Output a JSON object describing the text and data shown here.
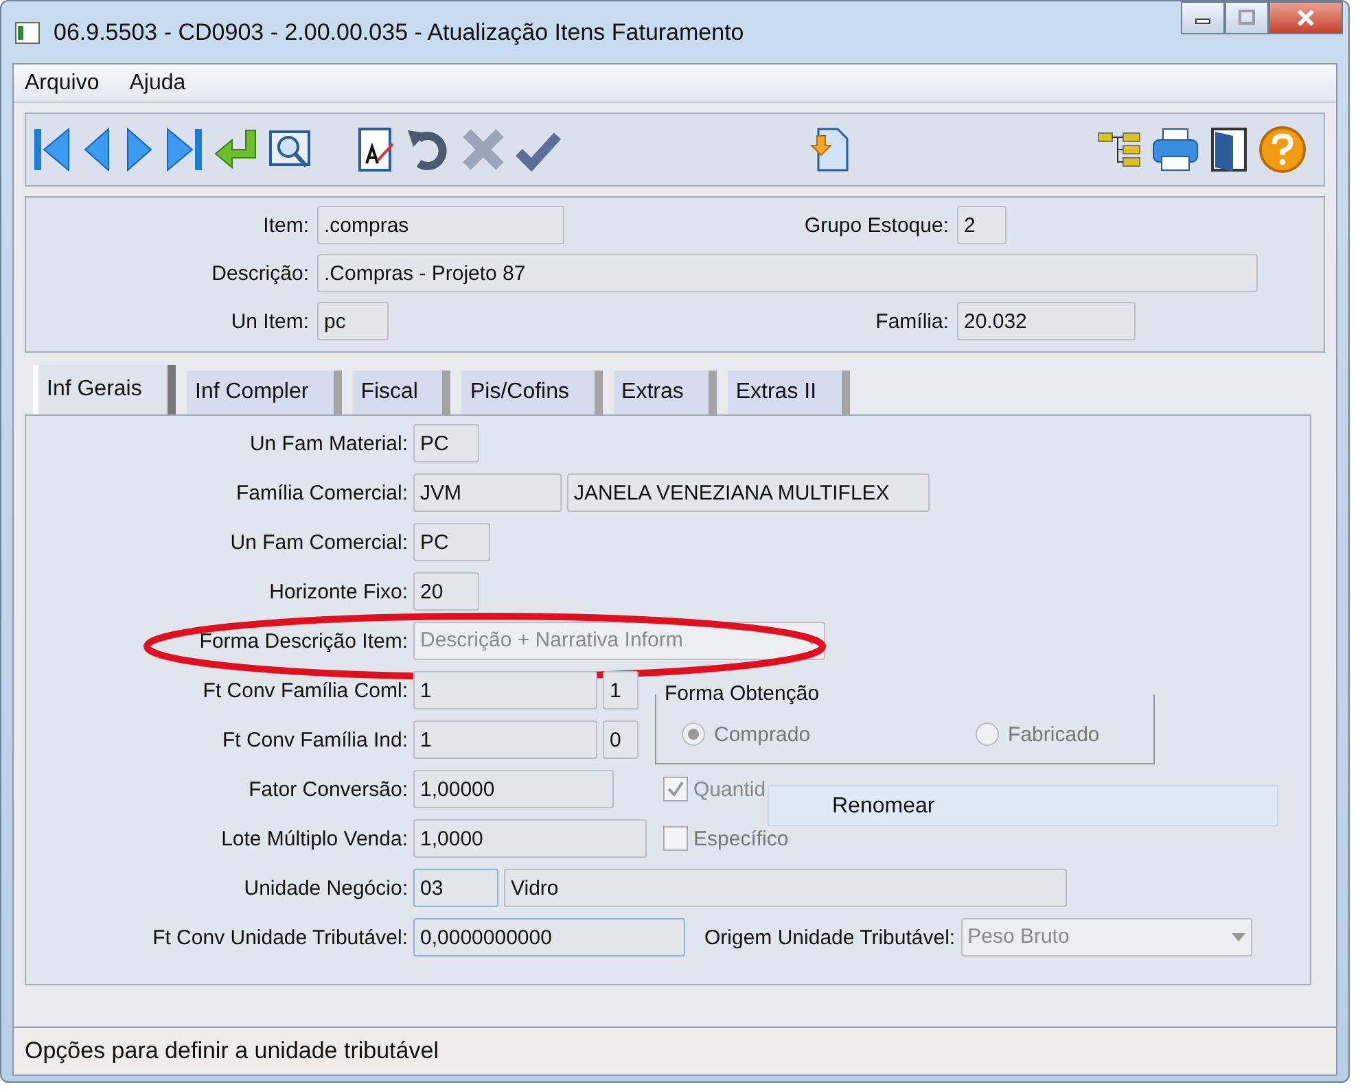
{
  "window": {
    "title": "06.9.5503 - CD0903 - 2.00.00.035 - Atualização Itens Faturamento"
  },
  "menu": [
    "Arquivo",
    "Ajuda"
  ],
  "header": [
    {
      "label": "Item:",
      "value": ".compras",
      "right_label": "Grupo Estoque:",
      "right_value": "2"
    },
    {
      "label": "Descrição:",
      "value": ".Compras - Projeto 87"
    },
    {
      "label": "Un Item:",
      "value": "pc",
      "right_label": "Família:",
      "right_value": "20.032"
    }
  ],
  "tabs": [
    {
      "label": "Inf Gerais",
      "selected": true
    },
    {
      "label": "Inf Compler",
      "selected": false
    },
    {
      "label": "Fiscal",
      "selected": false
    },
    {
      "label": "Pis/Cofins",
      "selected": false
    },
    {
      "label": "Extras",
      "selected": false
    },
    {
      "label": "Extras II",
      "selected": false
    }
  ],
  "form": [
    {
      "label": "Un Fam Material:",
      "fields": [
        {
          "kind": "input",
          "value": "PC"
        }
      ]
    },
    {
      "label": "Família Comercial:",
      "fields": [
        {
          "kind": "input",
          "value": "JVM"
        },
        {
          "kind": "input",
          "value": "JANELA VENEZIANA MULTIFLEX"
        }
      ]
    },
    {
      "label": "Un Fam Comercial:",
      "fields": [
        {
          "kind": "input",
          "value": "PC"
        }
      ]
    },
    {
      "label": "Horizonte Fixo:",
      "fields": [
        {
          "kind": "input",
          "value": "20"
        }
      ]
    },
    {
      "label": "Forma Descrição Item:",
      "highlighted": true,
      "fields": [
        {
          "kind": "combo",
          "value": "Descrição + Narrativa Inform",
          "disabled": true
        }
      ]
    },
    {
      "label": "Ft Conv Família Coml:",
      "fields": [
        {
          "kind": "input",
          "value": "1"
        },
        {
          "kind": "input",
          "value": "1"
        }
      ]
    },
    {
      "label": "Ft Conv Família Ind:",
      "fields": [
        {
          "kind": "input",
          "value": "1"
        },
        {
          "kind": "input",
          "value": "0"
        }
      ]
    },
    {
      "label": "Fator Conversão:",
      "fields": [
        {
          "kind": "input",
          "value": "1,00000"
        }
      ],
      "right": {
        "kind": "checkbox",
        "label": "Quantid",
        "checked": true,
        "disabled": true
      }
    },
    {
      "label": "Lote Múltiplo Venda:",
      "fields": [
        {
          "kind": "input",
          "value": "1,0000"
        }
      ],
      "right": {
        "kind": "checkbox",
        "label": "Específico",
        "checked": false,
        "disabled": false
      }
    },
    {
      "label": "Unidade Negócio:",
      "fields": [
        {
          "kind": "input",
          "value": "03",
          "focused": true
        },
        {
          "kind": "input",
          "value": "Vidro"
        }
      ]
    },
    {
      "label": "Ft Conv Unidade Tributável:",
      "fields": [
        {
          "kind": "input",
          "value": "0,0000000000",
          "focused": true
        },
        {
          "kind": "label",
          "value": "Origem Unidade Tributável:"
        },
        {
          "kind": "combo",
          "value": "Peso Bruto",
          "disabled": true
        }
      ]
    }
  ],
  "group": {
    "title": "Forma Obtenção",
    "options": [
      {
        "label": "Comprado",
        "selected": true
      },
      {
        "label": "Fabricado",
        "selected": false
      }
    ]
  },
  "tooltip": "Renomear",
  "status_bar": "Opções para definir a unidade tributável"
}
